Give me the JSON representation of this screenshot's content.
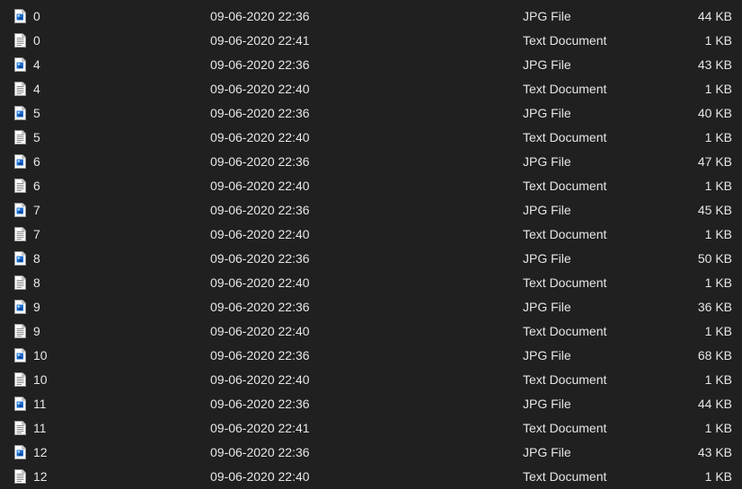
{
  "files": [
    {
      "name": "0",
      "date": "09-06-2020 22:36",
      "type": "JPG File",
      "size": "44 KB",
      "icon": "jpg-file-icon"
    },
    {
      "name": "0",
      "date": "09-06-2020 22:41",
      "type": "Text Document",
      "size": "1 KB",
      "icon": "text-file-icon"
    },
    {
      "name": "4",
      "date": "09-06-2020 22:36",
      "type": "JPG File",
      "size": "43 KB",
      "icon": "jpg-file-icon"
    },
    {
      "name": "4",
      "date": "09-06-2020 22:40",
      "type": "Text Document",
      "size": "1 KB",
      "icon": "text-file-icon"
    },
    {
      "name": "5",
      "date": "09-06-2020 22:36",
      "type": "JPG File",
      "size": "40 KB",
      "icon": "jpg-file-icon"
    },
    {
      "name": "5",
      "date": "09-06-2020 22:40",
      "type": "Text Document",
      "size": "1 KB",
      "icon": "text-file-icon"
    },
    {
      "name": "6",
      "date": "09-06-2020 22:36",
      "type": "JPG File",
      "size": "47 KB",
      "icon": "jpg-file-icon"
    },
    {
      "name": "6",
      "date": "09-06-2020 22:40",
      "type": "Text Document",
      "size": "1 KB",
      "icon": "text-file-icon"
    },
    {
      "name": "7",
      "date": "09-06-2020 22:36",
      "type": "JPG File",
      "size": "45 KB",
      "icon": "jpg-file-icon"
    },
    {
      "name": "7",
      "date": "09-06-2020 22:40",
      "type": "Text Document",
      "size": "1 KB",
      "icon": "text-file-icon"
    },
    {
      "name": "8",
      "date": "09-06-2020 22:36",
      "type": "JPG File",
      "size": "50 KB",
      "icon": "jpg-file-icon"
    },
    {
      "name": "8",
      "date": "09-06-2020 22:40",
      "type": "Text Document",
      "size": "1 KB",
      "icon": "text-file-icon"
    },
    {
      "name": "9",
      "date": "09-06-2020 22:36",
      "type": "JPG File",
      "size": "36 KB",
      "icon": "jpg-file-icon"
    },
    {
      "name": "9",
      "date": "09-06-2020 22:40",
      "type": "Text Document",
      "size": "1 KB",
      "icon": "text-file-icon"
    },
    {
      "name": "10",
      "date": "09-06-2020 22:36",
      "type": "JPG File",
      "size": "68 KB",
      "icon": "jpg-file-icon"
    },
    {
      "name": "10",
      "date": "09-06-2020 22:40",
      "type": "Text Document",
      "size": "1 KB",
      "icon": "text-file-icon"
    },
    {
      "name": "11",
      "date": "09-06-2020 22:36",
      "type": "JPG File",
      "size": "44 KB",
      "icon": "jpg-file-icon"
    },
    {
      "name": "11",
      "date": "09-06-2020 22:41",
      "type": "Text Document",
      "size": "1 KB",
      "icon": "text-file-icon"
    },
    {
      "name": "12",
      "date": "09-06-2020 22:36",
      "type": "JPG File",
      "size": "43 KB",
      "icon": "jpg-file-icon"
    },
    {
      "name": "12",
      "date": "09-06-2020 22:40",
      "type": "Text Document",
      "size": "1 KB",
      "icon": "text-file-icon"
    }
  ],
  "colors": {
    "background": "#202020",
    "text": "#e6e6e6",
    "jpg_icon_accent": "#1f6fd1"
  }
}
